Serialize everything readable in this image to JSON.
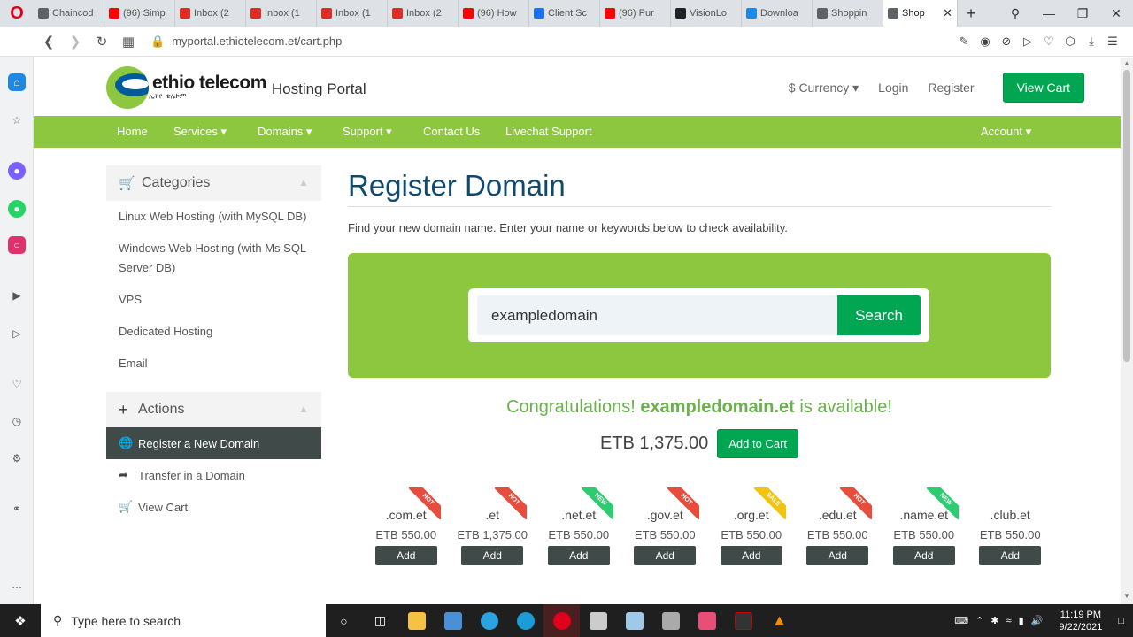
{
  "browser": {
    "tabs": [
      {
        "label": "Chaincod",
        "color": "#5f6368"
      },
      {
        "label": "(96) Simp",
        "color": "#ff0000"
      },
      {
        "label": "Inbox (2",
        "color": "#d93025"
      },
      {
        "label": "Inbox (1",
        "color": "#d93025"
      },
      {
        "label": "Inbox (1",
        "color": "#d93025"
      },
      {
        "label": "Inbox (2",
        "color": "#d93025"
      },
      {
        "label": "(96) How",
        "color": "#ff0000"
      },
      {
        "label": "Client Sc",
        "color": "#1a73e8"
      },
      {
        "label": "(96) Pur",
        "color": "#ff0000"
      },
      {
        "label": "VisionLo",
        "color": "#222222"
      },
      {
        "label": "Downloa",
        "color": "#1e88e5"
      },
      {
        "label": "Shoppin",
        "color": "#5f6368"
      },
      {
        "label": "Shop",
        "color": "#5f6368"
      }
    ],
    "url": "myportal.ethiotelecom.et/cart.php"
  },
  "header": {
    "brand": "ethio telecom",
    "brand_sub": "ኢትዮ ቴሌኮም",
    "tagline": "Hosting Portal",
    "currency_label": "Currency",
    "login_label": "Login",
    "register_label": "Register",
    "view_cart_label": "View Cart"
  },
  "nav": {
    "home": "Home",
    "services": "Services",
    "domains": "Domains",
    "support": "Support",
    "contact": "Contact Us",
    "livechat": "Livechat Support",
    "account": "Account"
  },
  "categories": {
    "title": "Categories",
    "items": [
      "Linux Web Hosting (with MySQL DB)",
      "Windows Web Hosting (with Ms SQL Server DB)",
      "VPS",
      "Dedicated Hosting",
      "Email"
    ]
  },
  "actions": {
    "title": "Actions",
    "items": [
      "Register a New Domain",
      "Transfer in a Domain",
      "View Cart"
    ]
  },
  "main": {
    "title": "Register Domain",
    "intro": "Find your new domain name. Enter your name or keywords below to check availability.",
    "search_value": "exampledomain",
    "search_button": "Search",
    "congrats_prefix": "Congratulations! ",
    "congrats_domain": "exampledomain.et",
    "congrats_suffix": " is available!",
    "price": "ETB 1,375.00",
    "add_to_cart": "Add to Cart"
  },
  "tlds": [
    {
      "name": ".com.et",
      "price": "ETB 550.00",
      "add": "Add",
      "badge": "HOT",
      "badge_color": "#e74c3c"
    },
    {
      "name": ".et",
      "price": "ETB 1,375.00",
      "add": "Add",
      "badge": "HOT",
      "badge_color": "#e74c3c"
    },
    {
      "name": ".net.et",
      "price": "ETB 550.00",
      "add": "Add",
      "badge": "NEW",
      "badge_color": "#2ecc71"
    },
    {
      "name": ".gov.et",
      "price": "ETB 550.00",
      "add": "Add",
      "badge": "HOT",
      "badge_color": "#e74c3c"
    },
    {
      "name": ".org.et",
      "price": "ETB 550.00",
      "add": "Add",
      "badge": "SALE",
      "badge_color": "#f1c40f"
    },
    {
      "name": ".edu.et",
      "price": "ETB 550.00",
      "add": "Add",
      "badge": "HOT",
      "badge_color": "#e74c3c"
    },
    {
      "name": ".name.et",
      "price": "ETB 550.00",
      "add": "Add",
      "badge": "NEW",
      "badge_color": "#2ecc71"
    },
    {
      "name": ".club.et",
      "price": "ETB 550.00",
      "add": "Add",
      "badge": "",
      "badge_color": ""
    }
  ],
  "taskbar": {
    "search_placeholder": "Type here to search",
    "time": "11:19 PM",
    "date": "9/22/2021"
  },
  "colors": {
    "brand_green": "#8dc63f",
    "button_green": "#00a651",
    "title_blue": "#0f4a6e"
  }
}
